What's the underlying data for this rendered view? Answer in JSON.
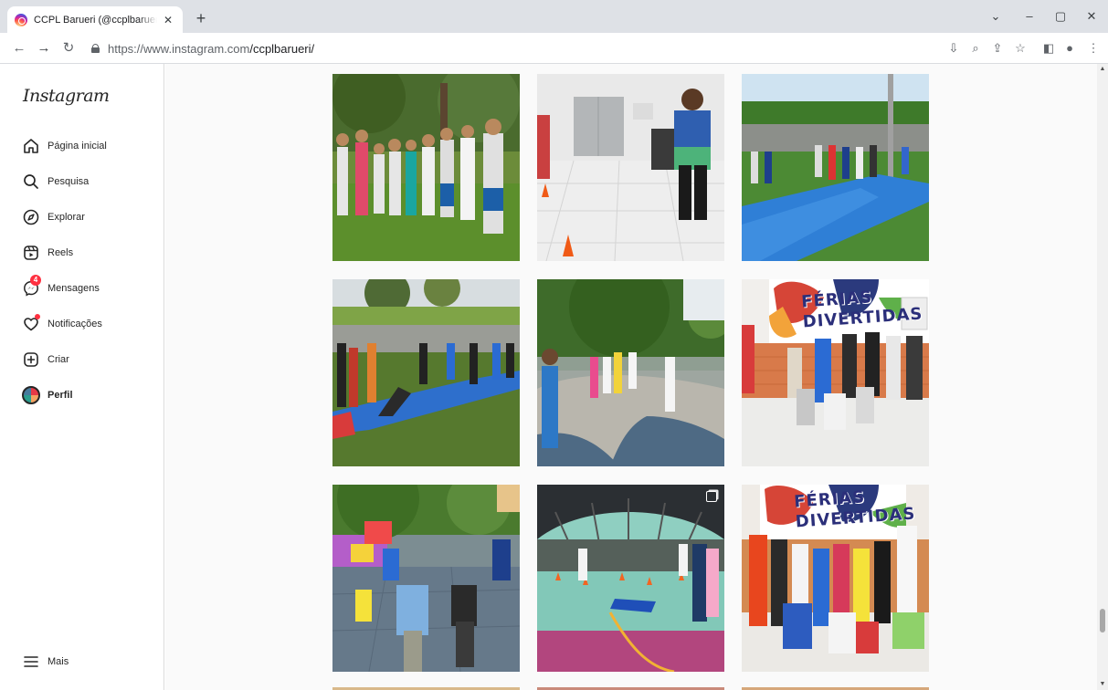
{
  "browser": {
    "tab_title": "CCPL Barueri (@ccplbarueri) • Fotos",
    "tab_close": "✕",
    "new_tab": "+",
    "url_host": "https://www.instagram.com",
    "url_path": "/ccplbarueri/"
  },
  "sidebar": {
    "logo": "Instagram",
    "items": [
      {
        "label": "Página inicial",
        "icon": "home-icon"
      },
      {
        "label": "Pesquisa",
        "icon": "search-icon"
      },
      {
        "label": "Explorar",
        "icon": "compass-icon"
      },
      {
        "label": "Reels",
        "icon": "reels-icon"
      },
      {
        "label": "Mensagens",
        "icon": "messenger-icon",
        "badge": "4"
      },
      {
        "label": "Notificações",
        "icon": "heart-icon"
      },
      {
        "label": "Criar",
        "icon": "plus-square-icon"
      },
      {
        "label": "Perfil",
        "icon": "avatar"
      }
    ],
    "more": "Mais"
  },
  "posts": [
    {
      "text": ""
    },
    {
      "text": ""
    },
    {
      "text": ""
    },
    {
      "text": ""
    },
    {
      "text": ""
    },
    {
      "text": "FÉRIAS\nDIVERTIDAS"
    },
    {
      "text": ""
    },
    {
      "text": ""
    },
    {
      "text": "FÉRIAS\nDIVERTIDAS"
    }
  ],
  "colors": {
    "accent": "#ff3040",
    "brand_text": "#262626",
    "feed_bg": "#fafafa"
  }
}
